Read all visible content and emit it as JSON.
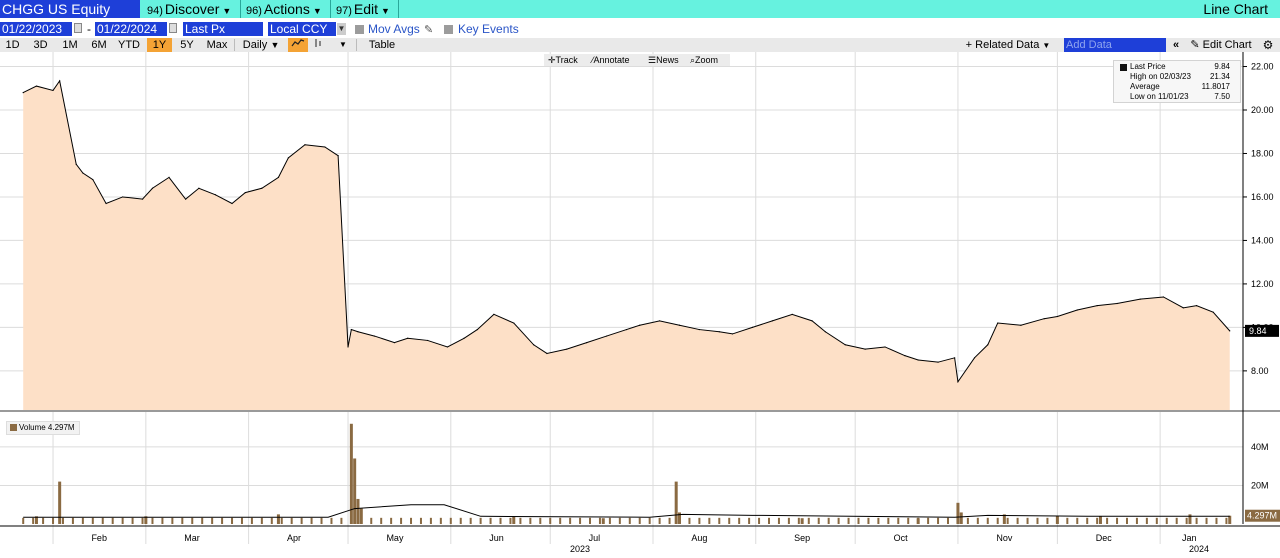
{
  "header": {
    "ticker": "CHGG US Equity",
    "menus": [
      {
        "num": "94)",
        "label": "Discover"
      },
      {
        "num": "96)",
        "label": "Actions"
      },
      {
        "num": "97)",
        "label": "Edit"
      }
    ],
    "chart_kind": "Line Chart"
  },
  "controls": {
    "start_date": "01/22/2023",
    "end_date": "01/22/2024",
    "dash": "-",
    "field": "Last Px",
    "currency": "Local CCY",
    "mov_avgs": "Mov Avgs",
    "key_events": "Key Events"
  },
  "toolbar": {
    "ranges": [
      "1D",
      "3D",
      "1M",
      "6M",
      "YTD",
      "1Y",
      "5Y",
      "Max"
    ],
    "active_range": "1Y",
    "frequency": "Daily",
    "table": "Table",
    "related_data": "Related Data",
    "add_data_placeholder": "Add Data",
    "edit_chart": "Edit Chart"
  },
  "chart_tools": [
    "Track",
    "Annotate",
    "News",
    "Zoom"
  ],
  "legend": {
    "last_price_label": "Last Price",
    "last_price_value": "9.84",
    "high_label": "High on 02/03/23",
    "high_value": "21.34",
    "average_label": "Average",
    "average_value": "11.8017",
    "low_label": "Low on 11/01/23",
    "low_value": "7.50"
  },
  "volume_legend": "Volume 4.297M",
  "price_tag": "9.84",
  "volume_tag": "4.297M",
  "colors": {
    "area_fill": "#fde0c7",
    "line": "#000000",
    "volume_bar": "#8a6a42",
    "accent": "#f4a335"
  },
  "chart_data": [
    {
      "type": "area",
      "title": "",
      "x_tick_labels": [
        "Feb",
        "Mar",
        "Apr",
        "May",
        "Jun",
        "Jul",
        "Aug",
        "Sep",
        "Oct",
        "Nov",
        "Dec",
        "Jan"
      ],
      "x_year_labels": [
        "2023",
        "2024"
      ],
      "y_ticks": [
        "8.00",
        "10.00",
        "12.00",
        "14.00",
        "16.00",
        "18.00",
        "20.00",
        "22.00"
      ],
      "ylim": [
        6.2,
        22.3
      ],
      "grid": true,
      "legend_position": "top-right",
      "series": [
        {
          "name": "Last Price",
          "x": [
            "2023-01-23",
            "2023-01-27",
            "2023-02-01",
            "2023-02-03",
            "2023-02-08",
            "2023-02-10",
            "2023-02-13",
            "2023-02-17",
            "2023-02-22",
            "2023-02-28",
            "2023-03-03",
            "2023-03-08",
            "2023-03-13",
            "2023-03-17",
            "2023-03-22",
            "2023-03-27",
            "2023-03-31",
            "2023-04-05",
            "2023-04-10",
            "2023-04-13",
            "2023-04-18",
            "2023-04-24",
            "2023-04-28",
            "2023-05-01",
            "2023-05-02",
            "2023-05-04",
            "2023-05-09",
            "2023-05-15",
            "2023-05-19",
            "2023-05-25",
            "2023-05-31",
            "2023-06-05",
            "2023-06-09",
            "2023-06-14",
            "2023-06-20",
            "2023-06-26",
            "2023-06-30",
            "2023-07-06",
            "2023-07-12",
            "2023-07-18",
            "2023-07-24",
            "2023-07-28",
            "2023-08-03",
            "2023-08-09",
            "2023-08-15",
            "2023-08-21",
            "2023-08-25",
            "2023-08-31",
            "2023-09-06",
            "2023-09-12",
            "2023-09-18",
            "2023-09-22",
            "2023-09-28",
            "2023-10-04",
            "2023-10-10",
            "2023-10-16",
            "2023-10-20",
            "2023-10-26",
            "2023-10-31",
            "2023-11-01",
            "2023-11-06",
            "2023-11-10",
            "2023-11-13",
            "2023-11-20",
            "2023-11-27",
            "2023-12-01",
            "2023-12-07",
            "2023-12-13",
            "2023-12-19",
            "2023-12-26",
            "2024-01-02",
            "2024-01-08",
            "2024-01-12",
            "2024-01-17",
            "2024-01-22"
          ],
          "y": [
            20.8,
            21.1,
            20.9,
            21.34,
            17.5,
            17.1,
            16.8,
            15.7,
            16.0,
            15.9,
            16.4,
            16.9,
            15.9,
            16.4,
            16.1,
            15.7,
            16.2,
            16.4,
            16.9,
            17.8,
            18.4,
            18.3,
            17.9,
            9.1,
            9.9,
            9.8,
            9.6,
            9.3,
            9.5,
            9.4,
            9.1,
            9.5,
            9.9,
            10.6,
            10.2,
            9.2,
            8.8,
            9.0,
            9.3,
            9.6,
            9.9,
            10.1,
            10.3,
            10.1,
            9.9,
            9.8,
            9.7,
            10.0,
            10.3,
            10.6,
            10.3,
            9.8,
            9.2,
            9.0,
            9.1,
            8.7,
            8.5,
            8.4,
            8.6,
            7.5,
            8.6,
            9.2,
            10.2,
            10.1,
            10.4,
            10.5,
            10.8,
            11.0,
            11.1,
            11.3,
            11.4,
            10.9,
            11.0,
            10.7,
            9.84
          ]
        }
      ]
    },
    {
      "type": "bar",
      "title": "",
      "series_name": "Volume",
      "y_ticks": [
        "20M",
        "40M"
      ],
      "ylim": [
        0,
        55
      ],
      "grid": true,
      "series": [
        {
          "name": "Volume",
          "x": [
            "2023-01-27",
            "2023-02-03",
            "2023-03-01",
            "2023-04-10",
            "2023-05-02",
            "2023-05-03",
            "2023-05-04",
            "2023-05-05",
            "2023-06-20",
            "2023-07-17",
            "2023-08-08",
            "2023-08-09",
            "2023-09-15",
            "2023-10-20",
            "2023-11-01",
            "2023-11-02",
            "2023-11-15",
            "2023-12-01",
            "2023-12-14",
            "2024-01-10",
            "2024-01-22"
          ],
          "values": [
            4,
            22,
            4,
            5,
            52,
            34,
            13,
            8,
            4,
            3,
            22,
            6,
            3,
            3,
            11,
            6,
            5,
            4,
            4,
            5,
            4.297
          ]
        }
      ]
    }
  ]
}
